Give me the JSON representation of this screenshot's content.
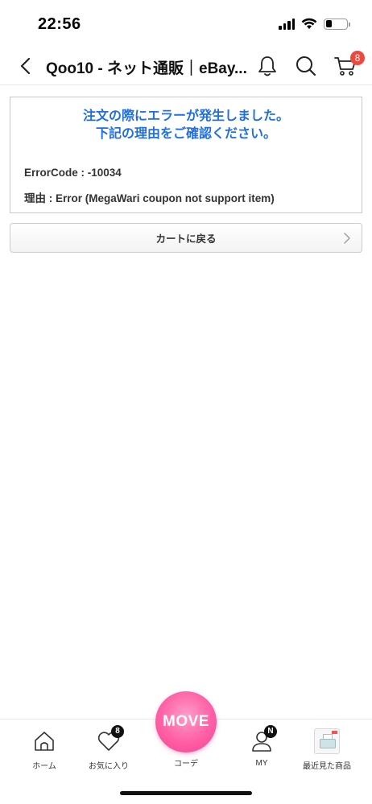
{
  "status_bar": {
    "time": "22:56",
    "icons": [
      "signal-icon",
      "wifi-icon",
      "battery-icon"
    ],
    "battery_level": 0.3
  },
  "nav": {
    "title": "Qoo10 - ネット通販｜eBay...",
    "cart_count": "8",
    "icons": [
      "back-arrow-icon",
      "bell-icon",
      "search-icon",
      "cart-icon"
    ]
  },
  "error": {
    "title_line1": "注文の際にエラーが発生しました。",
    "title_line2": "下記の理由をご確認ください。",
    "code": "ErrorCode : -10034",
    "reason": "理由 : Error (MegaWari coupon not support item)",
    "title_color": "#1f6fe0"
  },
  "back_to_cart": {
    "label": "カートに戻る"
  },
  "tab_bar": {
    "home_label": "ホーム",
    "favorites_label": "お気に入り",
    "favorites_badge": "8",
    "move_label": "MOVE",
    "coordinate_label": "コーデ",
    "my_label": "MY",
    "my_badge": "N",
    "recent_label": "最近見た商品",
    "accent_color": "#ff5fa5"
  }
}
